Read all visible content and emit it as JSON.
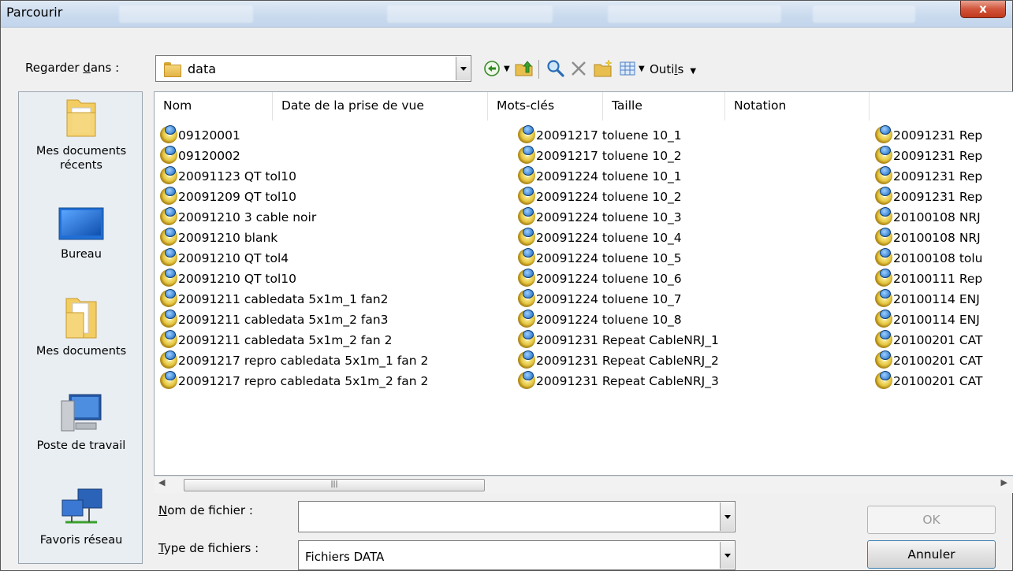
{
  "window": {
    "title": "Parcourir",
    "close_label": "x"
  },
  "lookin": {
    "label_pre": "Regarder ",
    "label_ul": "d",
    "label_post": "ans :",
    "value": "data"
  },
  "toolbar": {
    "tools_pre": "Outi",
    "tools_ul": "l",
    "tools_post": "s"
  },
  "places": [
    {
      "label": "Mes documents récents",
      "icon": "recent-folder-icon"
    },
    {
      "label": "Bureau",
      "icon": "desktop-icon"
    },
    {
      "label": "Mes documents",
      "icon": "documents-folder-icon"
    },
    {
      "label": "Poste de travail",
      "icon": "computer-icon"
    },
    {
      "label": "Favoris réseau",
      "icon": "network-icon"
    }
  ],
  "columns": [
    "Nom",
    "Date de la prise de vue",
    "Mots-clés",
    "Taille",
    "Notation"
  ],
  "files": {
    "col1": [
      "09120001",
      "09120002",
      "20091123 QT tol10",
      "20091209 QT tol10",
      "20091210 3 cable noir",
      "20091210 blank",
      "20091210 QT tol4",
      "20091210 QT tol10",
      "20091211 cabledata 5x1m_1 fan2",
      "20091211 cabledata 5x1m_2 fan3",
      "20091211 cabledata 5x1m_2 fan 2",
      "20091217 repro cabledata 5x1m_1 fan 2",
      "20091217 repro cabledata 5x1m_2 fan 2"
    ],
    "col2": [
      "20091217 toluene 10_1",
      "20091217 toluene 10_2",
      "20091224 toluene 10_1",
      "20091224 toluene 10_2",
      "20091224 toluene 10_3",
      "20091224 toluene 10_4",
      "20091224 toluene 10_5",
      "20091224 toluene 10_6",
      "20091224 toluene 10_7",
      "20091224 toluene 10_8",
      "20091231 Repeat CableNRJ_1",
      "20091231 Repeat CableNRJ_2",
      "20091231 Repeat CableNRJ_3"
    ],
    "col3": [
      "20091231 Rep",
      "20091231 Rep",
      "20091231 Rep",
      "20091231 Rep",
      "20100108 NRJ",
      "20100108 NRJ",
      "20100108 tolu",
      "20100111 Rep",
      "20100114 ENJ",
      "20100114 ENJ",
      "20100201 CAT",
      "20100201 CAT",
      "20100201 CAT"
    ]
  },
  "filename": {
    "label_ul": "N",
    "label_post": "om de fichier :",
    "value": ""
  },
  "filetype": {
    "label_ul": "T",
    "label_post": "ype de fichiers :",
    "value": "Fichiers DATA"
  },
  "buttons": {
    "ok": "OK",
    "cancel": "Annuler"
  }
}
